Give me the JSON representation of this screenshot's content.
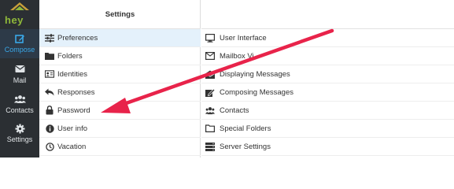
{
  "app": {
    "logo_text": "hey",
    "colors": {
      "sidebar": "#2b2f33",
      "active_nav": "#3aa8e8",
      "active_row": "#e4f1fb",
      "arrow": "#e8234a",
      "logo": "#8fb83a"
    }
  },
  "sidebar": {
    "items": [
      {
        "label": "Compose",
        "icon": "compose-icon"
      },
      {
        "label": "Mail",
        "icon": "envelope-icon"
      },
      {
        "label": "Contacts",
        "icon": "people-icon"
      },
      {
        "label": "Settings",
        "icon": "gear-icon"
      }
    ]
  },
  "settings": {
    "title": "Settings",
    "items": [
      {
        "label": "Preferences",
        "icon": "sliders-icon"
      },
      {
        "label": "Folders",
        "icon": "folder-icon"
      },
      {
        "label": "Identities",
        "icon": "id-card-icon"
      },
      {
        "label": "Responses",
        "icon": "reply-icon"
      },
      {
        "label": "Password",
        "icon": "lock-icon"
      },
      {
        "label": "User info",
        "icon": "info-icon"
      },
      {
        "label": "Vacation",
        "icon": "clock-icon"
      }
    ]
  },
  "preferences": {
    "items": [
      {
        "label": "User Interface",
        "icon": "monitor-icon"
      },
      {
        "label": "Mailbox Vi",
        "icon": "envelope-outline-icon"
      },
      {
        "label": "Displaying Messages",
        "icon": "open-envelope-icon"
      },
      {
        "label": "Composing Messages",
        "icon": "edit-icon"
      },
      {
        "label": "Contacts",
        "icon": "people-icon"
      },
      {
        "label": "Special Folders",
        "icon": "folder-outline-icon"
      },
      {
        "label": "Server Settings",
        "icon": "server-icon"
      }
    ]
  }
}
